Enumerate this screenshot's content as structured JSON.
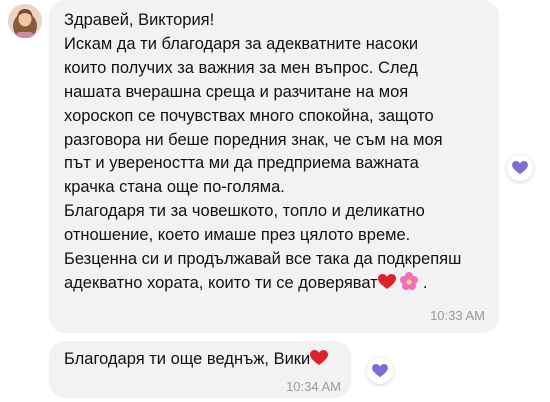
{
  "messages": [
    {
      "lines": [
        "Здравей, Виктория!",
        "Искам да ти благодаря за адекватните насоки",
        "които получих за важния  за мен въпрос. След",
        "нашата вчерашна среща и разчитане на моя",
        "хороскоп се почувствах много спокойна, защото",
        "разговора ни беше поредния знак, че съм на моя",
        "път и увереността ми да предприема важната",
        "крачка стана още по-голяма.",
        "Благодаря ти за човешкото, топло и деликатно",
        "отношение, което имаше през цялото време.",
        "Безценна си и продължавай все така да подкрепяш"
      ],
      "last_line": "адекватно хората, които ти се доверяват",
      "last_line_suffix": " .",
      "emojis": [
        "red-heart",
        "pink-flower"
      ],
      "time": "10:33 AM"
    },
    {
      "text": "Благодаря ти още веднъж, Вики",
      "emojis": [
        "red-heart"
      ],
      "time": "10:34 AM"
    }
  ],
  "colors": {
    "bubble": "#f2f2f2",
    "reaction_heart": "#7b6fd6",
    "heart": "#e0202a",
    "flower": "#f56bbf"
  }
}
